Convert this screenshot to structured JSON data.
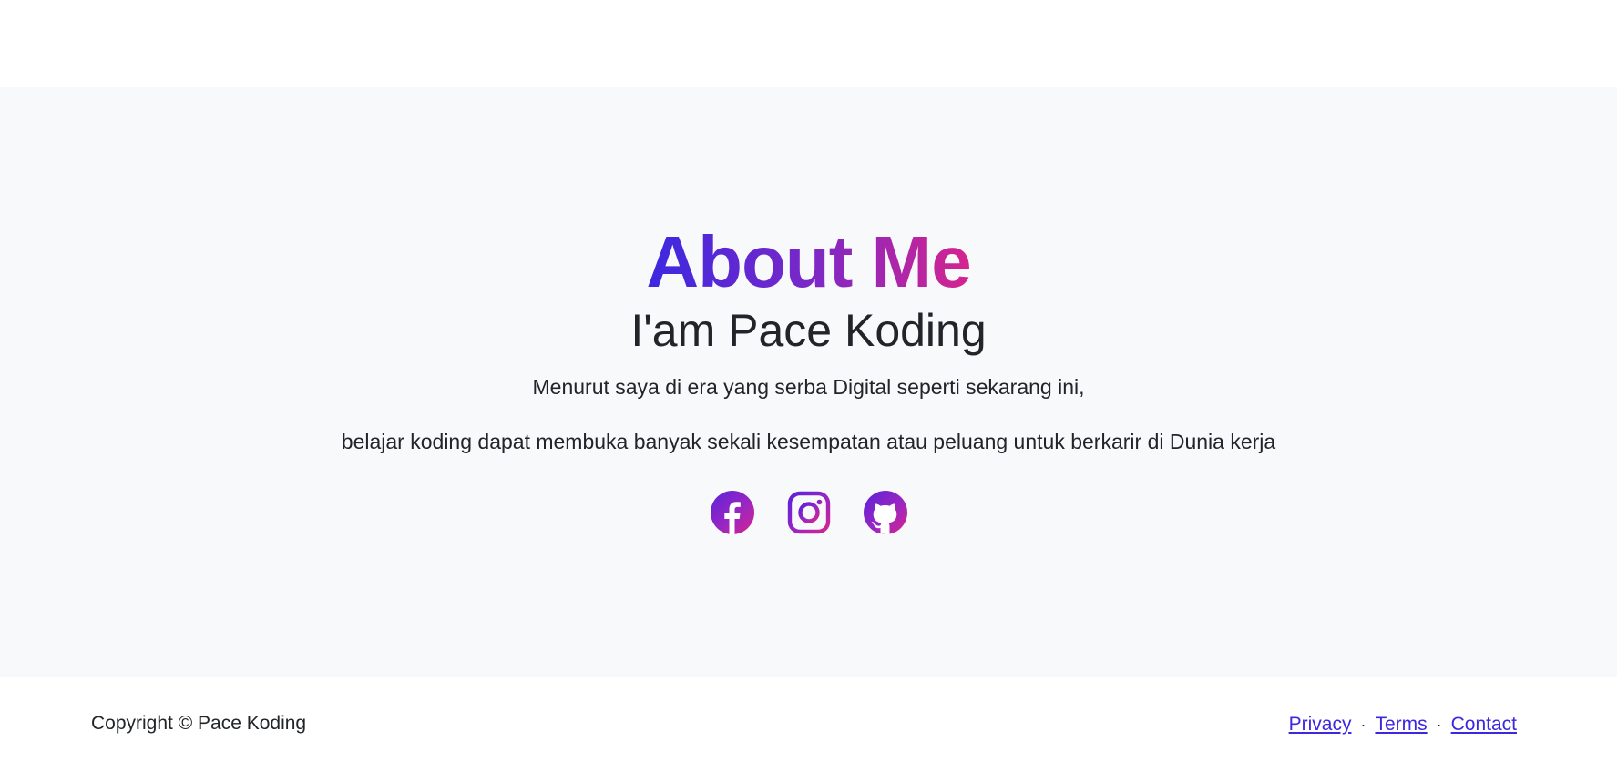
{
  "about": {
    "title": "About Me",
    "subtitle": "I'am Pace Koding",
    "line1": "Menurut saya di era yang serba Digital seperti sekarang ini,",
    "line2": "belajar koding dapat membuka banyak sekali kesempatan atau peluang untuk berkarir di Dunia kerja",
    "gradient_colors": [
      "#3b28e0",
      "#7a28c8",
      "#d6248e"
    ],
    "background": "#f8f9fa"
  },
  "social": [
    {
      "name": "facebook",
      "icon": "facebook-icon"
    },
    {
      "name": "instagram",
      "icon": "instagram-icon"
    },
    {
      "name": "github",
      "icon": "github-icon"
    }
  ],
  "footer": {
    "copyright": "Copyright © Pace Koding",
    "links": {
      "privacy": "Privacy",
      "terms": "Terms",
      "contact": "Contact"
    },
    "separator": "·",
    "link_color": "#3b28e0"
  }
}
